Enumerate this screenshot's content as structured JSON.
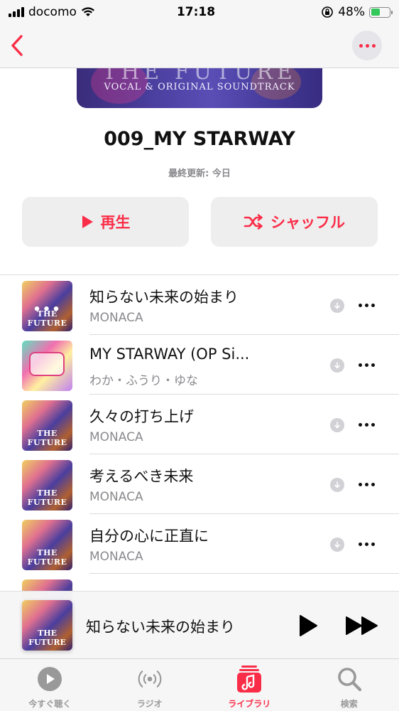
{
  "status_bar": {
    "carrier": "docomo",
    "time": "17:18",
    "battery_percent": "48%",
    "battery_level": 0.48
  },
  "nav": {
    "back_icon": "chevron-left-icon",
    "more_icon": "ellipsis-icon"
  },
  "artwork": {
    "top_text": "THE FUTURE",
    "subtitle": "VOCAL & ORIGINAL SOUNDTRACK"
  },
  "playlist": {
    "title": "009_MY STARWAY",
    "updated": "最終更新: 今日"
  },
  "actions": {
    "play_label": "再生",
    "shuffle_label": "シャッフル"
  },
  "tracks": [
    {
      "title": "知らない未来の始まり",
      "artist": "MONACA",
      "now_playing": true
    },
    {
      "title": "MY STARWAY (OP Si...",
      "artist": "わか・ふうり・ゆな",
      "now_playing": false
    },
    {
      "title": "久々の打ち上げ",
      "artist": "MONACA",
      "now_playing": false
    },
    {
      "title": "考えるべき未来",
      "artist": "MONACA",
      "now_playing": false
    },
    {
      "title": "自分の心に正直に",
      "artist": "MONACA",
      "now_playing": false
    }
  ],
  "cover_word": "THE FUTURE",
  "mini_player": {
    "title": "知らない未来の始まり"
  },
  "tabs": [
    {
      "label": "今すぐ聴く",
      "icon": "play-circle-icon"
    },
    {
      "label": "ラジオ",
      "icon": "radio-waves-icon"
    },
    {
      "label": "ライブラリ",
      "icon": "music-library-icon",
      "active": true
    },
    {
      "label": "検索",
      "icon": "search-icon"
    }
  ],
  "colors": {
    "accent": "#fa2d48",
    "secondary_text": "#8a8a8e",
    "button_bg": "#eeeeef"
  }
}
